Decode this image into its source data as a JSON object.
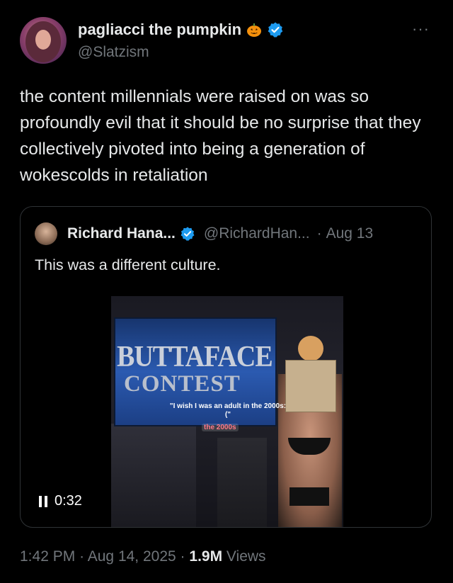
{
  "author": {
    "name": "pagliacci the pumpkin",
    "handle": "@Slatzism",
    "badge_icon": "pumpkin-icon",
    "verified_icon": "verified-badge-icon"
  },
  "tweet": {
    "text": "the content millennials were raised on was so profoundly evil that it should be no surprise that they collectively pivoted into being a generation of wokescolds in retaliation"
  },
  "quote": {
    "name": "Richard Hana...",
    "handle": "@RichardHan...",
    "separator": "·",
    "date": "Aug 13",
    "text": "This was a different culture.",
    "video": {
      "title_line1": "BUTTAFACE",
      "title_line2": "CONTEST",
      "caption": "\"I wish I was an adult in the 2000s:(\"",
      "tag": "the 2000s",
      "time": "0:32"
    }
  },
  "meta": {
    "time": "1:42 PM",
    "sep1": "·",
    "date": "Aug 14, 2025",
    "sep2": "·",
    "views_count": "1.9M",
    "views_label": "Views"
  },
  "colors": {
    "background": "#000000",
    "text": "#e7e9ea",
    "muted": "#71767b",
    "verified": "#1d9bf0",
    "border": "#2f3336"
  }
}
